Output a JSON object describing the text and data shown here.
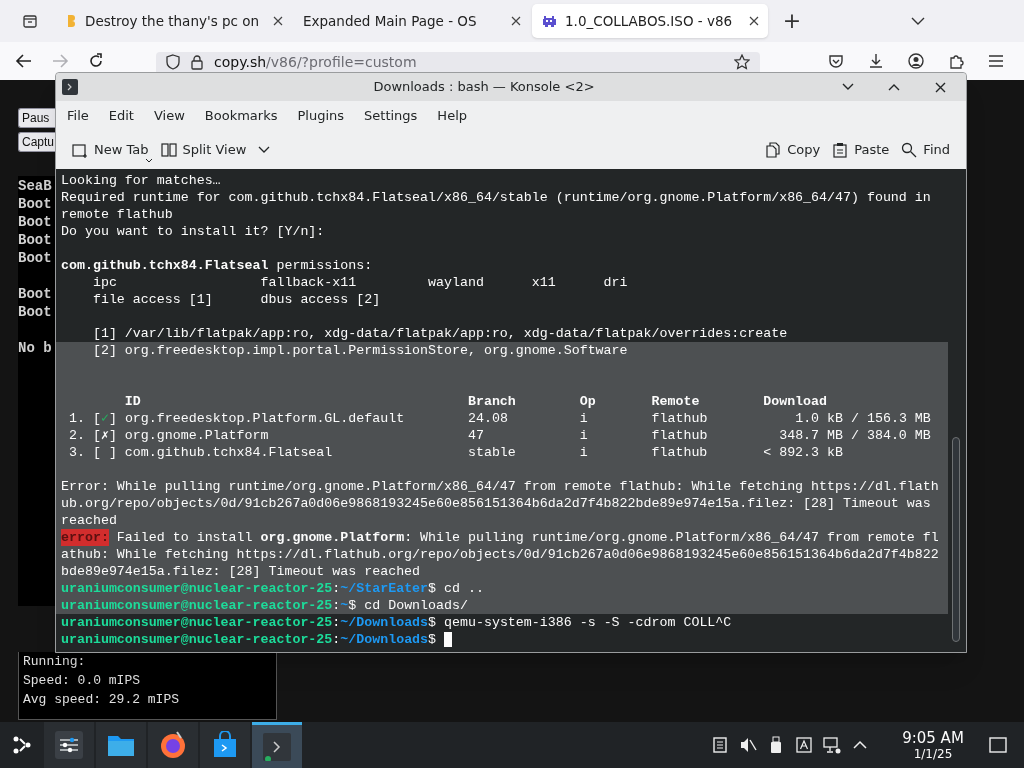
{
  "browser": {
    "tabs": [
      {
        "title": "Destroy the thany's pc on",
        "selected": false,
        "kind": "glyph"
      },
      {
        "title": "Expanded Main Page - OS",
        "selected": false,
        "kind": "plain"
      },
      {
        "title": "1.0_COLLABOS.ISO - v86",
        "selected": true,
        "kind": "invader"
      }
    ],
    "new_tab": "+",
    "forward_enabled": false,
    "url": {
      "host": "copy.sh",
      "path": "/v86/?profile=custom"
    }
  },
  "page": {
    "buttons": [
      "Paus",
      "Captu"
    ],
    "screen_blocks": [
      [
        "SeaB",
        "Boot",
        "Boot",
        "Boot",
        "Boot"
      ],
      [
        "Boot",
        "Boot"
      ],
      [
        "No b"
      ]
    ],
    "stats": [
      "Running:",
      "Speed: 0.0 mIPS",
      "Avg speed: 29.2 mIPS"
    ]
  },
  "konsole": {
    "title": "Downloads : bash — Konsole <2>",
    "menu": [
      "File",
      "Edit",
      "View",
      "Bookmarks",
      "Plugins",
      "Settings",
      "Help"
    ],
    "toolbar_left": [
      {
        "label": "New Tab",
        "kind": "newtab"
      },
      {
        "label": "Split View",
        "kind": "split"
      }
    ],
    "toolbar_right": [
      {
        "label": "Copy",
        "kind": "copy"
      },
      {
        "label": "Paste",
        "kind": "paste"
      },
      {
        "label": "Find",
        "kind": "find"
      }
    ],
    "lines": [
      {
        "kind": "text",
        "selected": false,
        "segments": [
          {
            "text": "Looking for matches…",
            "kind": "plain"
          }
        ]
      },
      {
        "kind": "text",
        "selected": false,
        "segments": [
          {
            "text": "Required runtime for com.github.tchx84.Flatseal/x86_64/stable (runtime/org.gnome.Platform/x86_64/47) found in",
            "kind": "plain"
          }
        ]
      },
      {
        "kind": "text",
        "selected": false,
        "segments": [
          {
            "text": "remote flathub",
            "kind": "plain"
          }
        ]
      },
      {
        "kind": "text",
        "selected": false,
        "segments": [
          {
            "text": "Do you want to install it? [Y/n]:",
            "kind": "plain"
          }
        ]
      },
      {
        "kind": "blank",
        "selected": false
      },
      {
        "kind": "text",
        "selected": false,
        "segments": [
          {
            "text": "com.github.tchx84.Flatseal",
            "kind": "bold"
          },
          {
            "text": " permissions:",
            "kind": "plain"
          }
        ]
      },
      {
        "kind": "text",
        "selected": false,
        "segments": [
          {
            "text": "    ipc                  fallback-x11         wayland      x11      dri",
            "kind": "plain"
          }
        ]
      },
      {
        "kind": "text",
        "selected": false,
        "segments": [
          {
            "text": "    file access [1]      dbus access [2]",
            "kind": "plain"
          }
        ]
      },
      {
        "kind": "blank",
        "selected": false
      },
      {
        "kind": "text",
        "selected": false,
        "segments": [
          {
            "text": "    [1] /var/lib/flatpak/app:ro, xdg-data/flatpak/app:ro, xdg-data/flatpak/overrides:create",
            "kind": "plain"
          }
        ]
      },
      {
        "kind": "text",
        "selected": true,
        "segments": [
          {
            "text": "    [2] org.freedesktop.impl.portal.PermissionStore, org.gnome.Software",
            "kind": "plain"
          }
        ]
      },
      {
        "kind": "blank",
        "selected": true
      },
      {
        "kind": "blank",
        "selected": true
      },
      {
        "kind": "text",
        "selected": true,
        "segments": [
          {
            "text": "        ID                                         Branch        Op       Remote        Download",
            "kind": "bold"
          }
        ]
      },
      {
        "kind": "text",
        "selected": true,
        "segments": [
          {
            "text": " 1. [",
            "kind": "plain"
          },
          {
            "text": "✓",
            "kind": "check"
          },
          {
            "text": "] org.freedesktop.Platform.GL.default        24.08         i        flathub           1.0 kB / 156.3 MB",
            "kind": "plain"
          }
        ]
      },
      {
        "kind": "text",
        "selected": true,
        "segments": [
          {
            "text": " 2. [✗] org.gnome.Platform                         47            i        flathub         348.7 MB / 384.0 MB",
            "kind": "plain"
          }
        ]
      },
      {
        "kind": "text",
        "selected": true,
        "segments": [
          {
            "text": " 3. [ ] com.github.tchx84.Flatseal                 stable        i        flathub       < 892.3 kB",
            "kind": "plain"
          }
        ]
      },
      {
        "kind": "blank",
        "selected": true
      },
      {
        "kind": "text",
        "selected": true,
        "segments": [
          {
            "text": "Error: While pulling runtime/org.gnome.Platform/x86_64/47 from remote flathub: While fetching https://dl.flath",
            "kind": "plain"
          }
        ]
      },
      {
        "kind": "text",
        "selected": true,
        "segments": [
          {
            "text": "ub.org/repo/objects/0d/91cb267a0d06e9868193245e60e856151364b6da2d7f4b822bde89e974e15a.filez: [28] Timeout was",
            "kind": "plain"
          }
        ]
      },
      {
        "kind": "text",
        "selected": true,
        "segments": [
          {
            "text": "reached",
            "kind": "plain"
          }
        ]
      },
      {
        "kind": "text",
        "selected": true,
        "segments": [
          {
            "text": "error:",
            "kind": "error"
          },
          {
            "text": " Failed to install ",
            "kind": "plain"
          },
          {
            "text": "org.gnome.Platform",
            "kind": "bold"
          },
          {
            "text": ": While pulling runtime/org.gnome.Platform/x86_64/47 from remote fl",
            "kind": "plain"
          }
        ]
      },
      {
        "kind": "text",
        "selected": true,
        "segments": [
          {
            "text": "athub: While fetching https://dl.flathub.org/repo/objects/0d/91cb267a0d06e9868193245e60e856151364b6da2d7f4b822",
            "kind": "plain"
          }
        ]
      },
      {
        "kind": "text",
        "selected": true,
        "segments": [
          {
            "text": "bde89e974e15a.filez: [28] Timeout was reached",
            "kind": "plain"
          }
        ]
      },
      {
        "kind": "text",
        "selected": true,
        "segments": [
          {
            "text": "uraniumconsumer@nuclear-reactor-25",
            "kind": "user"
          },
          {
            "text": ":",
            "kind": "plain"
          },
          {
            "text": "~/StarEater",
            "kind": "path"
          },
          {
            "text": "$ cd ..",
            "kind": "plain"
          }
        ]
      },
      {
        "kind": "text",
        "selected": true,
        "segments": [
          {
            "text": "uraniumconsumer@nuclear-reactor-25",
            "kind": "user"
          },
          {
            "text": ":",
            "kind": "plain"
          },
          {
            "text": "~",
            "kind": "path"
          },
          {
            "text": "$ cd Downloads/",
            "kind": "plain"
          }
        ]
      },
      {
        "kind": "text",
        "selected": false,
        "segments": [
          {
            "text": "uraniumconsumer@nuclear-reactor-25",
            "kind": "user"
          },
          {
            "text": ":",
            "kind": "plain"
          },
          {
            "text": "~/Downloads",
            "kind": "path"
          },
          {
            "text": "$ qemu-system-i386 -s -S -cdrom COLL^C",
            "kind": "plain"
          }
        ]
      },
      {
        "kind": "prompt",
        "selected": false,
        "segments": [
          {
            "text": "uraniumconsumer@nuclear-reactor-25",
            "kind": "user"
          },
          {
            "text": ":",
            "kind": "plain"
          },
          {
            "text": "~/Downloads",
            "kind": "path"
          },
          {
            "text": "$ ",
            "kind": "plain"
          }
        ]
      }
    ]
  },
  "taskbar": {
    "apps": [
      {
        "kind": "settings",
        "active": false
      },
      {
        "kind": "files",
        "active": false
      },
      {
        "kind": "browser",
        "active": false
      },
      {
        "kind": "store",
        "active": false
      },
      {
        "kind": "terminal",
        "active": true
      }
    ],
    "clock": {
      "time": "9:05 AM",
      "date": "1/1/25"
    }
  }
}
